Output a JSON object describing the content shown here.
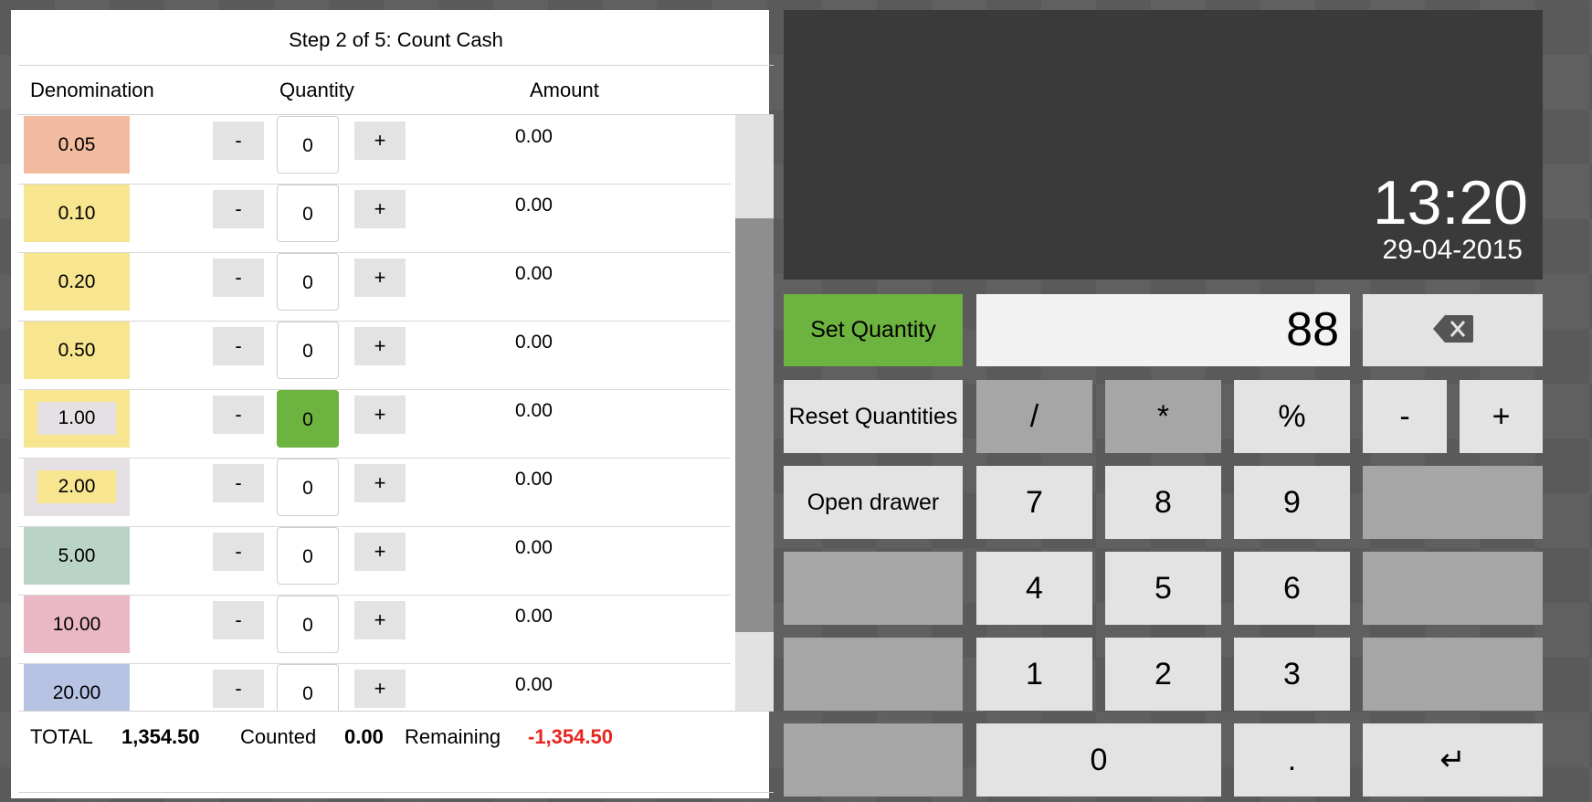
{
  "header": {
    "step_title": "Step 2 of 5: Count Cash"
  },
  "columns": {
    "denomination": "Denomination",
    "quantity": "Quantity",
    "amount": "Amount"
  },
  "rows": [
    {
      "denomination": "0.05",
      "quantity": "0",
      "amount": "0.00",
      "color": "#f2bb9f",
      "inner_color": ""
    },
    {
      "denomination": "0.10",
      "quantity": "0",
      "amount": "0.00",
      "color": "#f8e58f",
      "inner_color": ""
    },
    {
      "denomination": "0.20",
      "quantity": "0",
      "amount": "0.00",
      "color": "#f8e58f",
      "inner_color": ""
    },
    {
      "denomination": "0.50",
      "quantity": "0",
      "amount": "0.00",
      "color": "#f8e58f",
      "inner_color": ""
    },
    {
      "denomination": "1.00",
      "quantity": "0",
      "amount": "0.00",
      "color": "#f8e58f",
      "inner_color": "#e4e0e4",
      "active": true
    },
    {
      "denomination": "2.00",
      "quantity": "0",
      "amount": "0.00",
      "color": "#e4e0e4",
      "inner_color": "#f8e58f"
    },
    {
      "denomination": "5.00",
      "quantity": "0",
      "amount": "0.00",
      "color": "#b9d3c6",
      "inner_color": ""
    },
    {
      "denomination": "10.00",
      "quantity": "0",
      "amount": "0.00",
      "color": "#eab8c5",
      "inner_color": ""
    },
    {
      "denomination": "20.00",
      "quantity": "0",
      "amount": "0.00",
      "color": "#b7c3e3",
      "inner_color": ""
    }
  ],
  "buttons": {
    "minus": "-",
    "plus": "+"
  },
  "totals": {
    "total_label": "TOTAL",
    "total_value": "1,354.50",
    "counted_label": "Counted",
    "counted_value": "0.00",
    "remaining_label": "Remaining",
    "remaining_value": "-1,354.50"
  },
  "clock": {
    "time": "13:20",
    "date": "29-04-2015"
  },
  "keypad": {
    "display_value": "88",
    "set_quantity": "Set Quantity",
    "reset_quantities": "Reset Quantities",
    "open_drawer": "Open drawer",
    "divide": "/",
    "multiply": "*",
    "percent": "%",
    "minus": "-",
    "plus": "+",
    "d7": "7",
    "d8": "8",
    "d9": "9",
    "d4": "4",
    "d5": "5",
    "d6": "6",
    "d1": "1",
    "d2": "2",
    "d3": "3",
    "d0": "0",
    "dot": ".",
    "enter": "↵",
    "backspace_icon": "backspace-icon"
  },
  "colors": {
    "accent_green": "#6db33f",
    "negative_red": "#e8251f",
    "clock_bg": "#3a3a3a"
  }
}
